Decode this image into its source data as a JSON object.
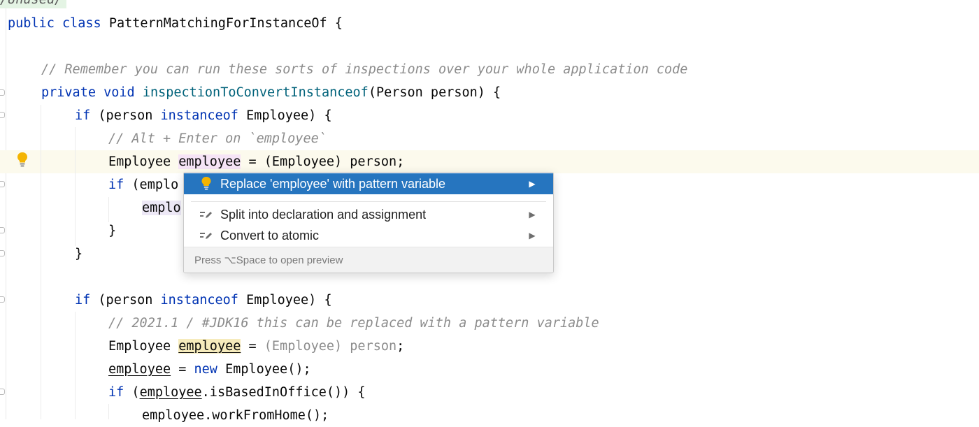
{
  "editor": {
    "lines": {
      "unused": "/Unused/",
      "l1_public": "public",
      "l1_class": "class",
      "l1_name": "PatternMatchingForInstanceOf",
      "l1_brace": "{",
      "l3_comment": "// Remember you can run these sorts of inspections over your whole application code",
      "l4_private": "private",
      "l4_void": "void",
      "l4_method": "inspectionToConvertInstanceof",
      "l4_params": "(Person person) {",
      "l5_if": "if",
      "l5_open": "(person",
      "l5_instanceof": "instanceof",
      "l5_rest": "Employee) {",
      "l6_comment": "// Alt + Enter on `employee`",
      "l7_type": "Employee",
      "l7_var": "employee",
      "l7_rest": "= (Employee) person;",
      "l8_if": "if",
      "l8_partial": "(emplo",
      "l9_partial": "emplo",
      "l10_brace": "}",
      "l11_brace": "}",
      "l13_if": "if",
      "l13_open": "(person",
      "l13_instanceof": "instanceof",
      "l13_rest": "Employee) {",
      "l14_comment": "// 2021.1 / #JDK16 this can be replaced with a pattern variable",
      "l15_type": "Employee",
      "l15_var": "employee",
      "l15_eq": "=",
      "l15_cast": "(Employee) person",
      "l15_semi": ";",
      "l16_var": "employee",
      "l16_eq": "=",
      "l16_new": "new",
      "l16_rest": "Employee();",
      "l17_if": "if",
      "l17_open": "(",
      "l17_var": "employee",
      "l17_rest": ".isBasedInOffice()) {",
      "l18_text": "employee.workFromHome();"
    }
  },
  "popup": {
    "items": [
      {
        "label": "Replace 'employee' with pattern variable",
        "icon": "lightbulb-icon",
        "selected": true
      },
      {
        "label": "Split into declaration and assignment",
        "icon": "edit-intention-icon",
        "selected": false
      },
      {
        "label": "Convert to atomic",
        "icon": "edit-intention-icon",
        "selected": false
      }
    ],
    "footer": "Press ⌥Space to open preview",
    "submenu_arrow": "▶"
  },
  "colors": {
    "keyword": "#0033b3",
    "method": "#00627a",
    "comment": "#8c8c8c",
    "selection": "#2675bf",
    "caret_row": "#fcfaed",
    "bulb": "#f4b400"
  }
}
